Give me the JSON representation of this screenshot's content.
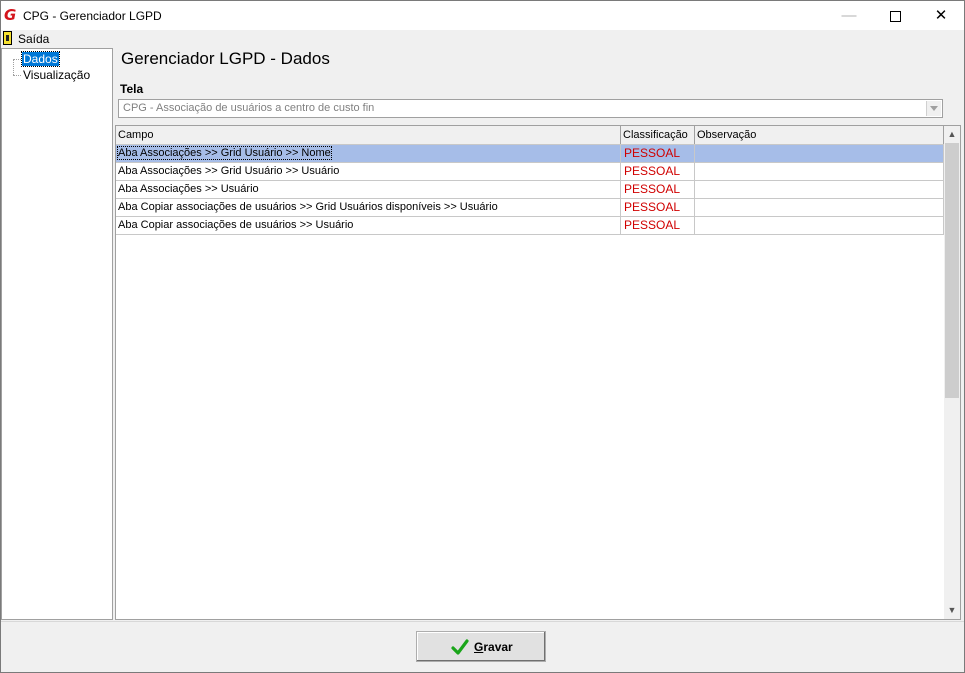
{
  "window": {
    "title": "CPG - Gerenciador LGPD"
  },
  "menu": {
    "items": [
      {
        "label": "Saída",
        "icon": "exit-door-icon"
      }
    ]
  },
  "tree": {
    "items": [
      {
        "label": "Dados",
        "selected": true
      },
      {
        "label": "Visualização",
        "selected": false
      }
    ]
  },
  "main": {
    "title": "Gerenciador LGPD - Dados",
    "tela_label": "Tela",
    "tela_value": "CPG - Associação de usuários a centro de custo fin"
  },
  "grid": {
    "columns": [
      "Campo",
      "Classificação",
      "Observação"
    ],
    "rows": [
      {
        "campo": "Aba Associações >> Grid Usuário >> Nome",
        "classificacao": "PESSOAL",
        "observacao": ""
      },
      {
        "campo": "Aba Associações >> Grid Usuário >> Usuário",
        "classificacao": "PESSOAL",
        "observacao": ""
      },
      {
        "campo": "Aba Associações >> Usuário",
        "classificacao": "PESSOAL",
        "observacao": ""
      },
      {
        "campo": "Aba Copiar associações de usuários >> Grid Usuários disponíveis >> Usuário",
        "classificacao": "PESSOAL",
        "observacao": ""
      },
      {
        "campo": "Aba Copiar associações de usuários >> Usuário",
        "classificacao": "PESSOAL",
        "observacao": ""
      }
    ]
  },
  "buttons": {
    "gravar_prefix": "",
    "gravar_mnemonic": "G",
    "gravar_rest": "ravar"
  },
  "colors": {
    "selection": "#a6bde8",
    "classification_text": "#d00000",
    "tree_selection": "#0078d7",
    "check_icon": "#1aa51a",
    "app_icon": "#d4141c"
  }
}
